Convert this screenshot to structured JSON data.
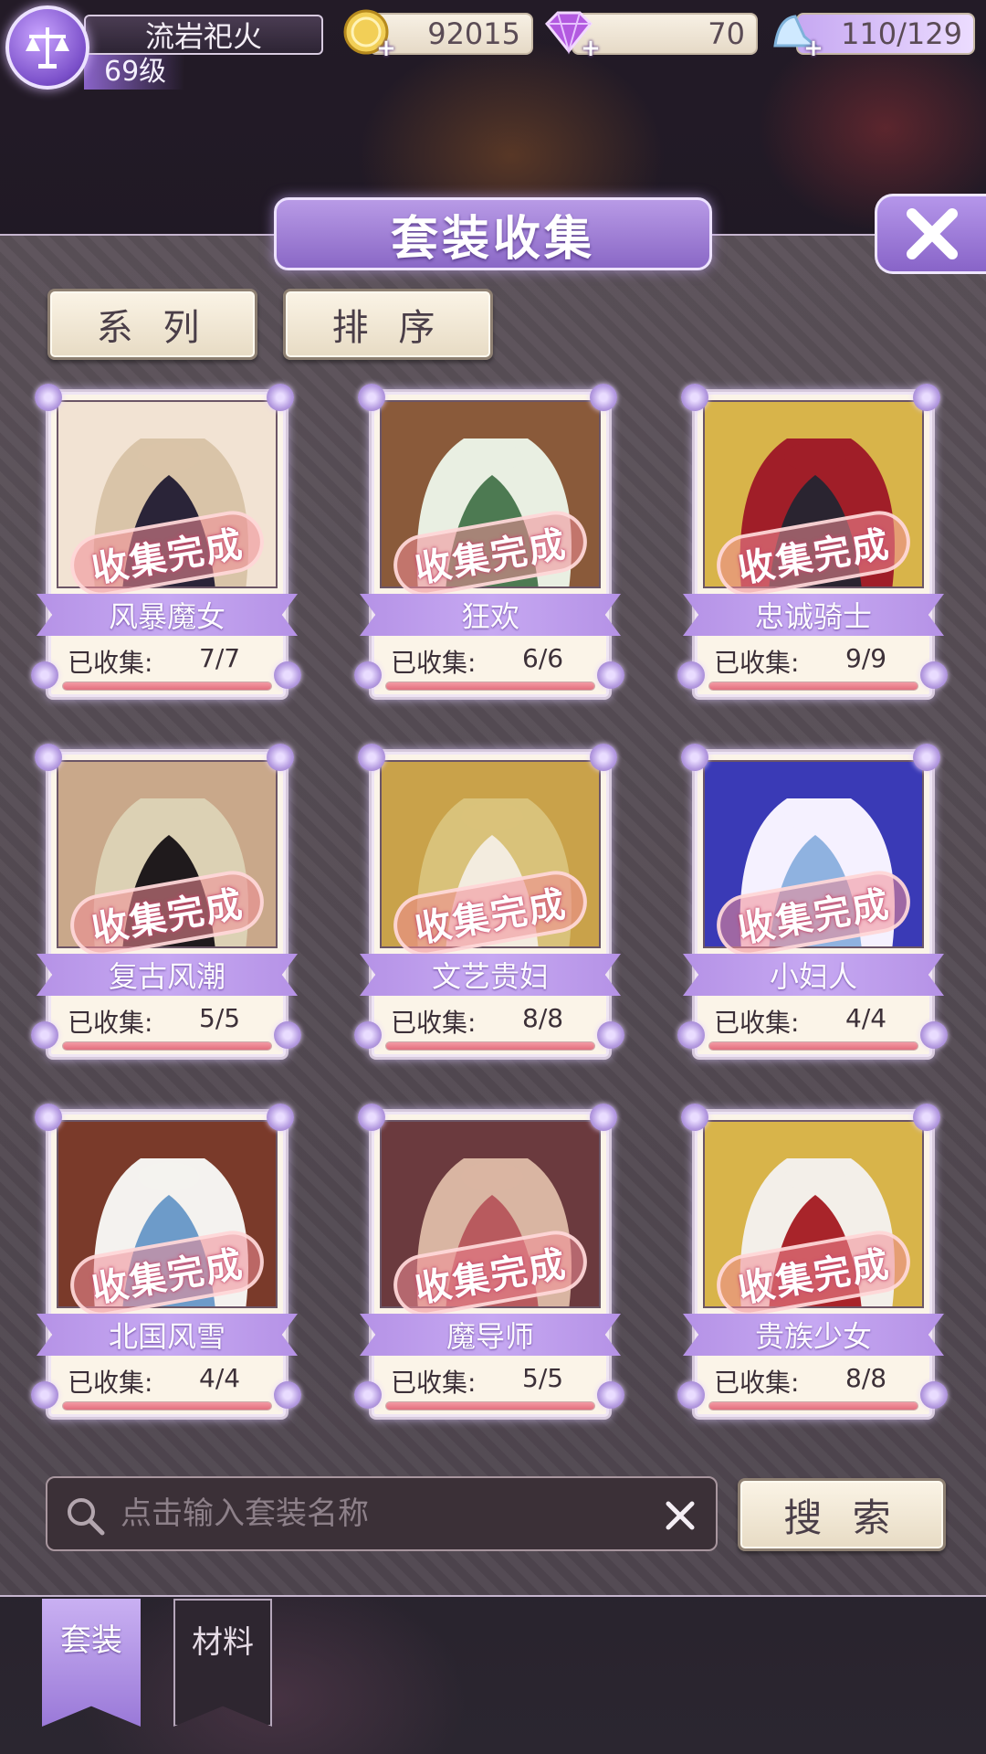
{
  "player": {
    "name": "流岩祀火",
    "level": "69级"
  },
  "resources": {
    "gold": "92015",
    "diamond": "70",
    "stamina": "110/129"
  },
  "page": {
    "title": "套装收集"
  },
  "filters": {
    "series": "系 列",
    "sort": "排 序"
  },
  "cards": [
    {
      "name": "风暴魔女",
      "label": "已收集:",
      "count": "7/7",
      "stamp": "收集完成",
      "progress": 1.0,
      "palette": [
        "#2a2438",
        "#d9c4a8",
        "#f2e3d3"
      ]
    },
    {
      "name": "狂欢",
      "label": "已收集:",
      "count": "6/6",
      "stamp": "收集完成",
      "progress": 1.0,
      "palette": [
        "#4d7a52",
        "#e9efe2",
        "#8a5a3a"
      ]
    },
    {
      "name": "忠诚骑士",
      "label": "已收集:",
      "count": "9/9",
      "stamp": "收集完成",
      "progress": 1.0,
      "palette": [
        "#2a2430",
        "#a01e28",
        "#d8b44a"
      ]
    },
    {
      "name": "复古风潮",
      "label": "已收集:",
      "count": "5/5",
      "stamp": "收集完成",
      "progress": 1.0,
      "palette": [
        "#1f1a1c",
        "#dcd1b4",
        "#c9a88a"
      ]
    },
    {
      "name": "文艺贵妇",
      "label": "已收集:",
      "count": "8/8",
      "stamp": "收集完成",
      "progress": 1.0,
      "palette": [
        "#f3ecdf",
        "#d9c27a",
        "#c9a24a"
      ]
    },
    {
      "name": "小妇人",
      "label": "已收集:",
      "count": "4/4",
      "stamp": "收集完成",
      "progress": 1.0,
      "palette": [
        "#8fb2e0",
        "#f5f1ff",
        "#3a3ab6"
      ]
    },
    {
      "name": "北国风雪",
      "label": "已收集:",
      "count": "4/4",
      "stamp": "收集完成",
      "progress": 1.0,
      "palette": [
        "#6d9bc9",
        "#f4f2ef",
        "#7a3a2a"
      ]
    },
    {
      "name": "魔导师",
      "label": "已收集:",
      "count": "5/5",
      "stamp": "收集完成",
      "progress": 1.0,
      "palette": [
        "#b85a5e",
        "#d9b5a2",
        "#6b3a3e"
      ]
    },
    {
      "name": "贵族少女",
      "label": "已收集:",
      "count": "8/8",
      "stamp": "收集完成",
      "progress": 1.0,
      "palette": [
        "#a8242a",
        "#f3efe9",
        "#d8b44a"
      ]
    }
  ],
  "search": {
    "placeholder": "点击输入套装名称",
    "button": "搜 索"
  },
  "tabs": {
    "suits": "套装",
    "materials": "材料"
  },
  "icons": {
    "emblem": "scales-icon",
    "gold": "coin-icon",
    "diamond": "diamond-icon",
    "stamina": "glass-slipper-icon",
    "close": "close-icon",
    "search": "search-icon",
    "clear": "clear-icon"
  },
  "colors": {
    "accent": "#a683e0",
    "progress": "#e2707e",
    "panel": "#544a53"
  }
}
